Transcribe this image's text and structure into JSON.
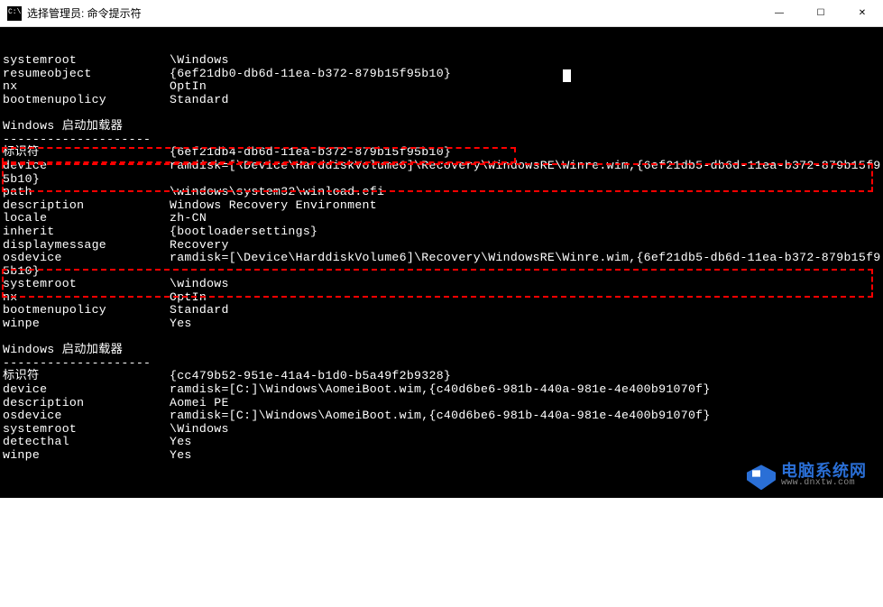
{
  "window": {
    "title": "选择管理员: 命令提示符",
    "controls": {
      "min": "—",
      "max": "☐",
      "close": "✕"
    }
  },
  "top_block": {
    "rows": [
      {
        "key": "systemroot",
        "val": "\\Windows"
      },
      {
        "key": "resumeobject",
        "val": "{6ef21db0-db6d-11ea-b372-879b15f95b10}"
      },
      {
        "key": "nx",
        "val": "OptIn"
      },
      {
        "key": "bootmenupolicy",
        "val": "Standard"
      }
    ]
  },
  "section1": {
    "heading": "Windows 启动加载器",
    "rows": [
      {
        "key": "标识符",
        "val": "{6ef21db4-db6d-11ea-b372-879b15f95b10}"
      },
      {
        "key": "device",
        "val": "ramdisk=[\\Device\\HarddiskVolume6]\\Recovery\\WindowsRE\\Winre.wim,{6ef21db5-db6d-11ea-b372-879b15f9"
      },
      {
        "key": "",
        "val": "5b10}"
      },
      {
        "key": "path",
        "val": "\\windows\\system32\\winload.efi"
      },
      {
        "key": "description",
        "val": "Windows Recovery Environment"
      },
      {
        "key": "locale",
        "val": "zh-CN"
      },
      {
        "key": "inherit",
        "val": "{bootloadersettings}"
      },
      {
        "key": "displaymessage",
        "val": "Recovery"
      },
      {
        "key": "osdevice",
        "val": "ramdisk=[\\Device\\HarddiskVolume6]\\Recovery\\WindowsRE\\Winre.wim,{6ef21db5-db6d-11ea-b372-879b15f9"
      },
      {
        "key": "",
        "val": "5b10}"
      },
      {
        "key": "systemroot",
        "val": "\\windows"
      },
      {
        "key": "nx",
        "val": "OptIn"
      },
      {
        "key": "bootmenupolicy",
        "val": "Standard"
      },
      {
        "key": "winpe",
        "val": "Yes"
      }
    ]
  },
  "section2": {
    "heading": "Windows 启动加载器",
    "rows": [
      {
        "key": "标识符",
        "val": "{cc479b52-951e-41a4-b1d0-b5a49f2b9328}"
      },
      {
        "key": "device",
        "val": "ramdisk=[C:]\\Windows\\AomeiBoot.wim,{c40d6be6-981b-440a-981e-4e400b91070f}"
      },
      {
        "key": "description",
        "val": "Aomei PE"
      },
      {
        "key": "osdevice",
        "val": "ramdisk=[C:]\\Windows\\AomeiBoot.wim,{c40d6be6-981b-440a-981e-4e400b91070f}"
      },
      {
        "key": "systemroot",
        "val": "\\Windows"
      },
      {
        "key": "detecthal",
        "val": "Yes"
      },
      {
        "key": "winpe",
        "val": "Yes"
      }
    ]
  },
  "watermark": {
    "line1": "电脑系统网",
    "line2": "www.dnxtw.com"
  }
}
